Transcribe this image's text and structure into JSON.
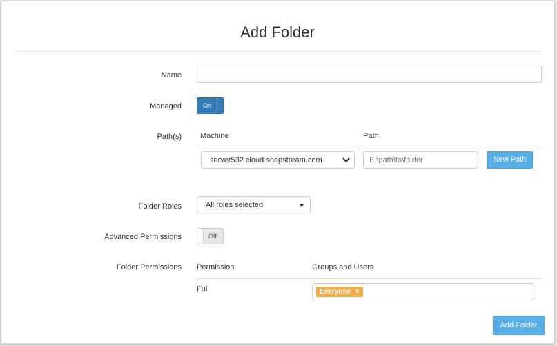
{
  "title": "Add Folder",
  "form": {
    "name_label": "Name",
    "name_value": "",
    "managed_label": "Managed",
    "managed_toggle": "On",
    "paths_label": "Path(s)",
    "machine_header": "Machine",
    "path_header": "Path",
    "machine_selected": "server532.cloud.snapstream.com",
    "path_placeholder": "E:\\path\\to\\folder",
    "new_path_button": "New Path",
    "folder_roles_label": "Folder Roles",
    "folder_roles_selected": "All roles selected",
    "advanced_permissions_label": "Advanced Permissions",
    "advanced_permissions_toggle": "Off",
    "folder_permissions_label": "Folder Permissions",
    "permission_header": "Permission",
    "groups_header": "Groups and Users",
    "permission_value": "Full",
    "group_tag": "Everyone",
    "tag_remove": "×"
  },
  "actions": {
    "add_folder_button": "Add Folder"
  },
  "colors": {
    "primary": "#337ab7",
    "button": "#5aaee6",
    "tag": "#f0ad4e"
  }
}
